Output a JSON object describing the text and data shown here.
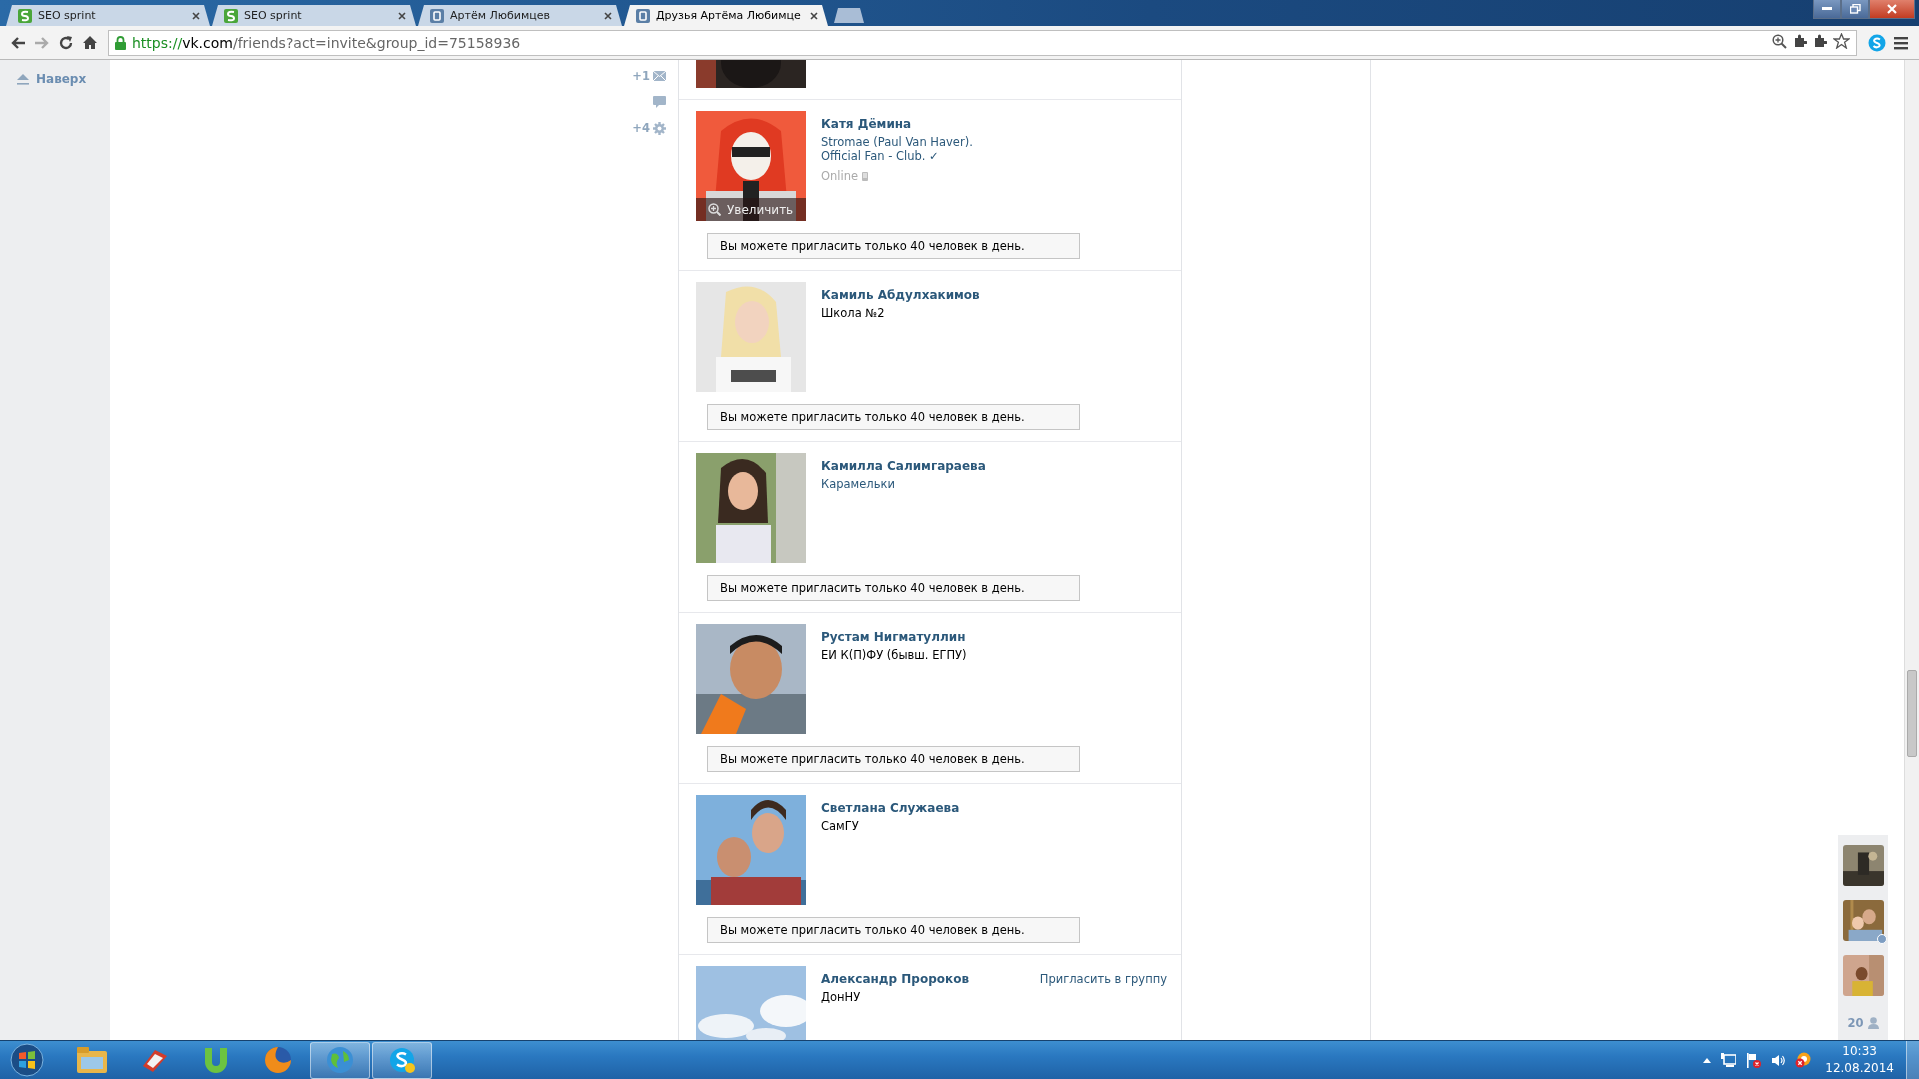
{
  "browser": {
    "tabs": [
      {
        "title": "SEO sprint",
        "kind": "seo",
        "selected": false
      },
      {
        "title": "SEO sprint",
        "kind": "seo",
        "selected": false
      },
      {
        "title": "Артём Любимцев",
        "kind": "vk",
        "selected": false
      },
      {
        "title": "Друзья Артёма Любимце",
        "kind": "vk",
        "selected": true
      }
    ],
    "address": {
      "scheme": "https://",
      "host": "vk.com",
      "path": "/friends?act=invite&group_id=75158936"
    }
  },
  "left_nav": {
    "back_to_top": "Наверх"
  },
  "counters": [
    {
      "kind": "messages",
      "count": "+1"
    },
    {
      "kind": "comments"
    },
    {
      "kind": "settings",
      "count": "+4"
    }
  ],
  "friends": [
    {
      "kind": "cut"
    },
    {
      "kind": "full",
      "name": "Катя Дёмина",
      "subtitle": "Stromae (Paul Van Haver). Official Fan - Club. ✓",
      "subtitle_link": true,
      "online": "Online",
      "zoom_label": "Увеличить",
      "notice": "Вы можете пригласить только 40 человек в день."
    },
    {
      "kind": "full",
      "name": "Камиль Абдулхакимов",
      "subtitle": "Школа №2",
      "subtitle_link": false,
      "notice": "Вы можете пригласить только 40 человек в день."
    },
    {
      "kind": "full",
      "name": "Камилла Салимгараева",
      "subtitle": "Карамельки",
      "subtitle_link": true,
      "notice": "Вы можете пригласить только 40 человек в день."
    },
    {
      "kind": "full",
      "name": "Рустам Нигматуллин",
      "subtitle": "ЕИ К(П)ФУ (бывш. ЕГПУ)",
      "subtitle_link": false,
      "notice": "Вы можете пригласить только 40 человек в день."
    },
    {
      "kind": "full",
      "name": "Светлана Служаева",
      "subtitle": "СамГУ",
      "subtitle_link": false,
      "notice": "Вы можете пригласить только 40 человек в день."
    },
    {
      "kind": "full",
      "name": "Александр Пророков",
      "subtitle": "ДонНУ",
      "subtitle_link": false,
      "action": "Пригласить в группу"
    }
  ],
  "fast_chat": {
    "friends": [
      {
        "online": false
      },
      {
        "online": true
      },
      {
        "online": false
      }
    ],
    "count": "20"
  },
  "taskbar": {
    "apps": [
      {
        "kind": "explorer",
        "active": false
      },
      {
        "kind": "cleaner",
        "active": false
      },
      {
        "kind": "torrent",
        "active": false
      },
      {
        "kind": "firefox",
        "active": false
      },
      {
        "kind": "globe",
        "active": true
      },
      {
        "kind": "skype",
        "active": true
      }
    ],
    "time": "10:33",
    "date": "12.08.2014"
  }
}
